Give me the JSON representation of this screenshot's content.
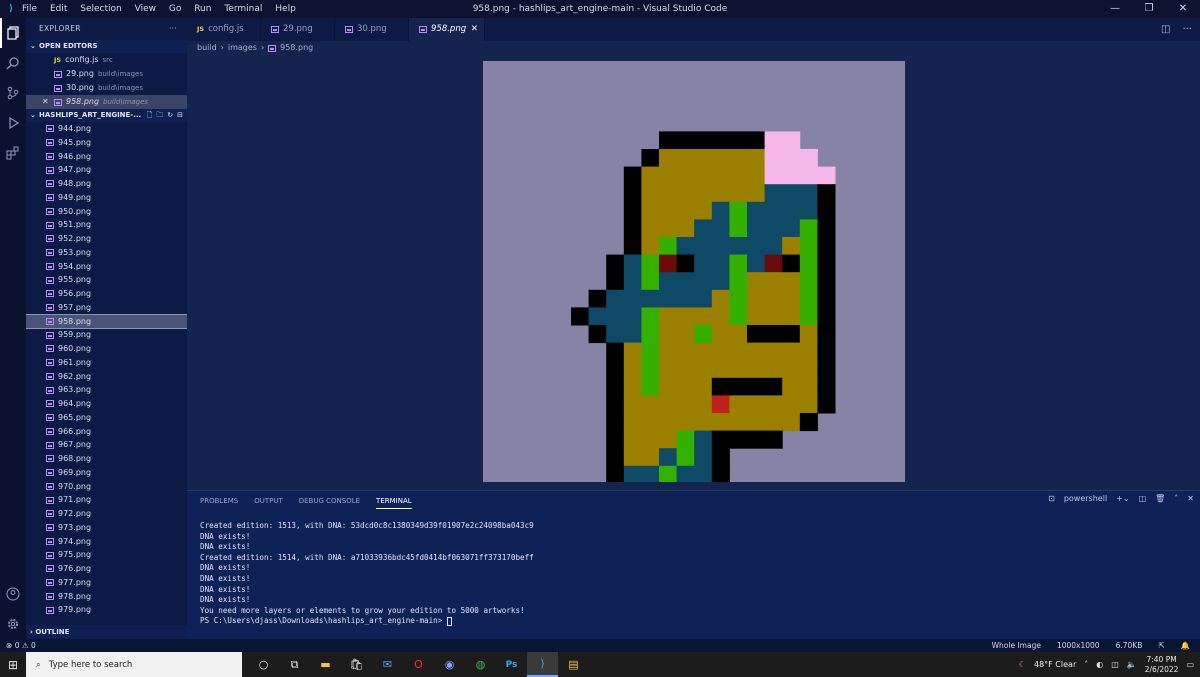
{
  "window": {
    "title": "958.png - hashlips_art_engine-main - Visual Studio Code",
    "menu": [
      "File",
      "Edit",
      "Selection",
      "View",
      "Go",
      "Run",
      "Terminal",
      "Help"
    ],
    "controls": [
      "—",
      "❐",
      "✕"
    ]
  },
  "sidebar": {
    "header": "EXPLORER",
    "open_editors_label": "OPEN EDITORS",
    "open_editors": [
      {
        "name": "config.js",
        "path": "src",
        "type": "js"
      },
      {
        "name": "29.png",
        "path": "build\\images",
        "type": "png"
      },
      {
        "name": "30.png",
        "path": "build\\images",
        "type": "png"
      },
      {
        "name": "958.png",
        "path": "build\\images",
        "type": "png"
      }
    ],
    "project_label": "HASHLIPS_ART_ENGINE-...",
    "files": [
      "944.png",
      "945.png",
      "946.png",
      "947.png",
      "948.png",
      "949.png",
      "950.png",
      "951.png",
      "952.png",
      "953.png",
      "954.png",
      "955.png",
      "956.png",
      "957.png",
      "958.png",
      "959.png",
      "960.png",
      "961.png",
      "962.png",
      "963.png",
      "964.png",
      "965.png",
      "966.png",
      "967.png",
      "968.png",
      "969.png",
      "970.png",
      "971.png",
      "972.png",
      "973.png",
      "974.png",
      "975.png",
      "976.png",
      "977.png",
      "978.png",
      "979.png"
    ],
    "selected_file": "958.png",
    "outline_label": "OUTLINE"
  },
  "tabs": [
    {
      "label": "config.js",
      "type": "js"
    },
    {
      "label": "29.png",
      "type": "png"
    },
    {
      "label": "30.png",
      "type": "png"
    },
    {
      "label": "958.png",
      "type": "png",
      "active": true
    }
  ],
  "breadcrumbs": [
    "build",
    "images",
    "958.png"
  ],
  "panel": {
    "tabs": [
      "PROBLEMS",
      "OUTPUT",
      "DEBUG CONSOLE",
      "TERMINAL"
    ],
    "active_tab": "TERMINAL",
    "shell": "powershell",
    "terminal_lines": [
      "Created edition: 1513, with DNA: 53dcd0c8c1380349d39f01907e2c24098ba043c9",
      "DNA exists!",
      "DNA exists!",
      "Created edition: 1514, with DNA: a71033936bdc45fd0414bf063071ff373170beff",
      "DNA exists!",
      "DNA exists!",
      "DNA exists!",
      "DNA exists!",
      "You need more layers or elements to grow your edition to 5000 artworks!",
      "PS C:\\Users\\djass\\Downloads\\hashlips_art_engine-main> "
    ]
  },
  "statusbar": {
    "errors": "0",
    "warnings": "0",
    "image_mode": "Whole Image",
    "dimensions": "1000x1000",
    "size": "6.70KB"
  },
  "taskbar": {
    "search_placeholder": "Type here to search",
    "weather": "48°F  Clear",
    "time": "7:40 PM",
    "date": "2/6/2022"
  },
  "colors": {
    "accent": "#3ea6ff",
    "preview_bg": "#8683a7",
    "skin": "#9b8000",
    "teal": "#0e4a66",
    "green": "#33b000",
    "pink": "#f5b6e8",
    "black": "#000000",
    "red": "#c0201c",
    "dark_red": "#6a0a0a"
  }
}
